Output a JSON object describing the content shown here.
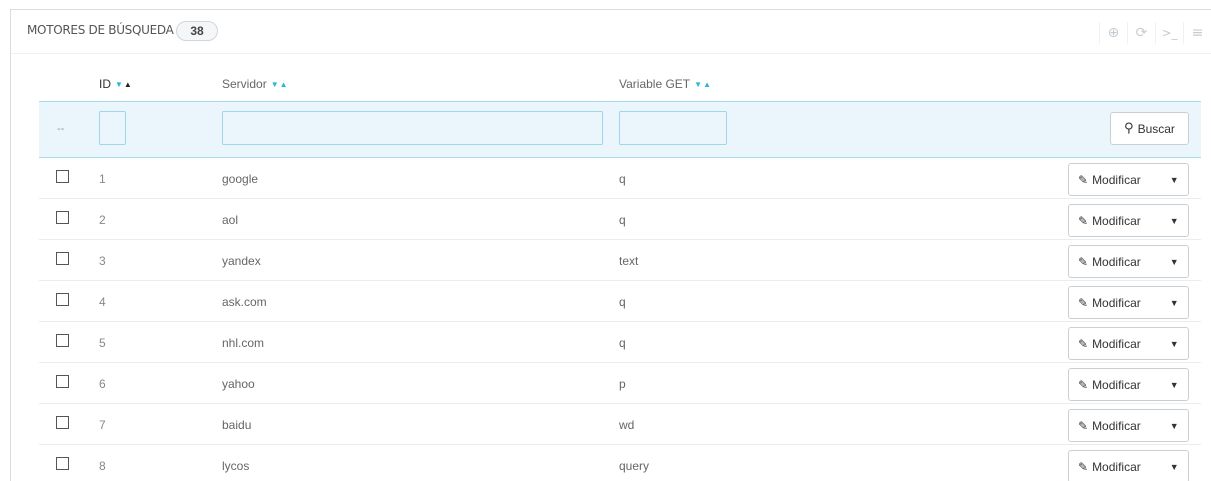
{
  "panel": {
    "title": "MOTORES DE BÚSQUEDA",
    "count": "38",
    "toolbar": [
      {
        "name": "add-icon",
        "glyph": "⊕"
      },
      {
        "name": "refresh-icon",
        "glyph": "⟳"
      },
      {
        "name": "sql-terminal-icon",
        "glyph": ">_"
      },
      {
        "name": "database-icon",
        "glyph": "≡"
      }
    ]
  },
  "columns": {
    "id": "ID",
    "server": "Servidor",
    "get_var": "Variable GET"
  },
  "filter": {
    "dash": "--",
    "id_value": "",
    "server_value": "",
    "getvar_value": "",
    "search_label": "Buscar"
  },
  "rows": [
    {
      "id": "1",
      "server": "google",
      "getvar": "q"
    },
    {
      "id": "2",
      "server": "aol",
      "getvar": "q"
    },
    {
      "id": "3",
      "server": "yandex",
      "getvar": "text"
    },
    {
      "id": "4",
      "server": "ask.com",
      "getvar": "q"
    },
    {
      "id": "5",
      "server": "nhl.com",
      "getvar": "q"
    },
    {
      "id": "6",
      "server": "yahoo",
      "getvar": "p"
    },
    {
      "id": "7",
      "server": "baidu",
      "getvar": "wd"
    },
    {
      "id": "8",
      "server": "lycos",
      "getvar": "query"
    }
  ],
  "row_action": {
    "edit_label": "Modificar"
  },
  "colors": {
    "accent": "#25b9d7",
    "filter_bg": "#eaf6fb",
    "border": "#d8dde2"
  }
}
